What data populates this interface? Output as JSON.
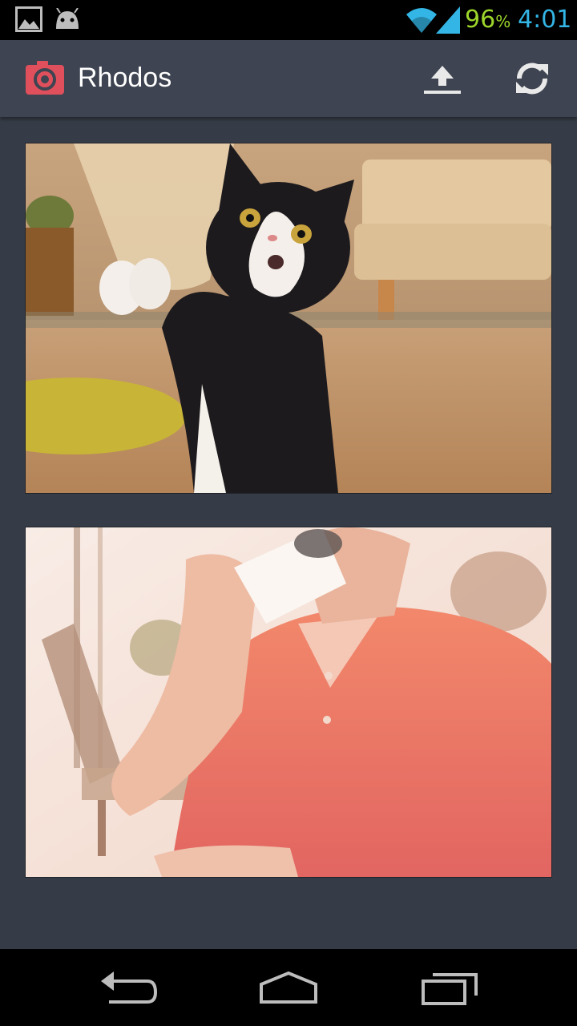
{
  "status_bar": {
    "left_icons": [
      "gallery-notification-icon",
      "android-notification-icon"
    ],
    "right_icons": [
      "wifi-icon",
      "signal-icon"
    ],
    "battery_value": "96",
    "battery_unit": "%",
    "time": "4:01",
    "colors": {
      "battery": "#9dd62b",
      "clock": "#33b5e5"
    }
  },
  "action_bar": {
    "app_icon": "camera-icon",
    "title": "Rhodos",
    "actions": [
      "upload-icon",
      "refresh-icon"
    ],
    "accent": "#e0505c"
  },
  "feed": {
    "photos": [
      {
        "subject": "kitten-photo"
      },
      {
        "subject": "man-drinking-coffee-photo"
      }
    ]
  },
  "nav_bar": {
    "buttons": [
      "back-icon",
      "home-icon",
      "recent-apps-icon"
    ]
  }
}
